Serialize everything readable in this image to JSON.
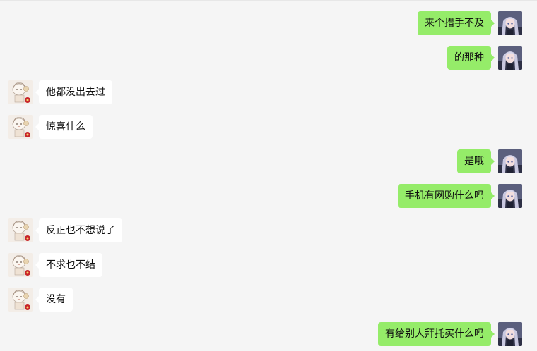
{
  "conversation": {
    "messages": [
      {
        "side": "right",
        "text": "来个措手不及"
      },
      {
        "side": "right",
        "text": "的那种"
      },
      {
        "side": "left",
        "text": "他都没出去过"
      },
      {
        "side": "left",
        "text": "惊喜什么"
      },
      {
        "side": "right",
        "text": "是哦"
      },
      {
        "side": "right",
        "text": "手机有网购什么吗"
      },
      {
        "side": "left",
        "text": "反正也不想说了"
      },
      {
        "side": "left",
        "text": "不求也不结"
      },
      {
        "side": "left",
        "text": "没有"
      },
      {
        "side": "right",
        "text": "有给别人拜托买什么吗"
      }
    ]
  },
  "colors": {
    "background": "#f5f5f5",
    "outgoing_bubble": "#95ec69",
    "incoming_bubble": "#ffffff",
    "text": "#111111"
  },
  "icons": {
    "self_avatar": "anime-girl-avatar",
    "contact_avatar": "chibi-sketch-avatar"
  }
}
